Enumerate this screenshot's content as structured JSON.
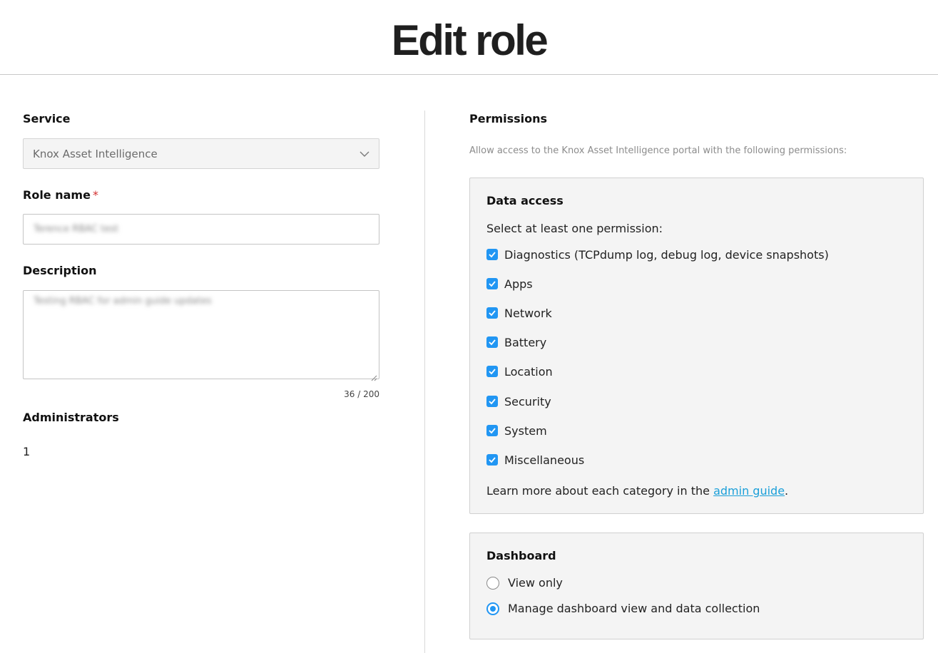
{
  "page": {
    "title": "Edit role"
  },
  "form": {
    "service_label": "Service",
    "service_value": "Knox Asset Intelligence",
    "role_name_label": "Role name",
    "role_name_required": "*",
    "role_name_value": "Terence RBAC test",
    "description_label": "Description",
    "description_value": "Testing RBAC for admin guide updates",
    "char_count": "36 / 200",
    "administrators_label": "Administrators",
    "administrators_count": "1"
  },
  "permissions": {
    "title": "Permissions",
    "description": "Allow access to the Knox Asset Intelligence portal with the following permissions:",
    "data_access": {
      "title": "Data access",
      "instruction": "Select at least one permission:",
      "items": [
        {
          "label": "Diagnostics (TCPdump log, debug log, device snapshots)",
          "checked": true
        },
        {
          "label": "Apps",
          "checked": true
        },
        {
          "label": "Network",
          "checked": true
        },
        {
          "label": "Battery",
          "checked": true
        },
        {
          "label": "Location",
          "checked": true
        },
        {
          "label": "Security",
          "checked": true
        },
        {
          "label": "System",
          "checked": true
        },
        {
          "label": "Miscellaneous",
          "checked": true
        }
      ],
      "learn_more_prefix": "Learn more about each category in the ",
      "learn_more_link": "admin guide",
      "learn_more_suffix": "."
    },
    "dashboard": {
      "title": "Dashboard",
      "options": [
        {
          "label": "View only",
          "selected": false
        },
        {
          "label": "Manage dashboard view and data collection",
          "selected": true
        }
      ]
    }
  },
  "colors": {
    "accent": "#2196f3",
    "link": "#1a9fd9",
    "required": "#d32f2f"
  }
}
